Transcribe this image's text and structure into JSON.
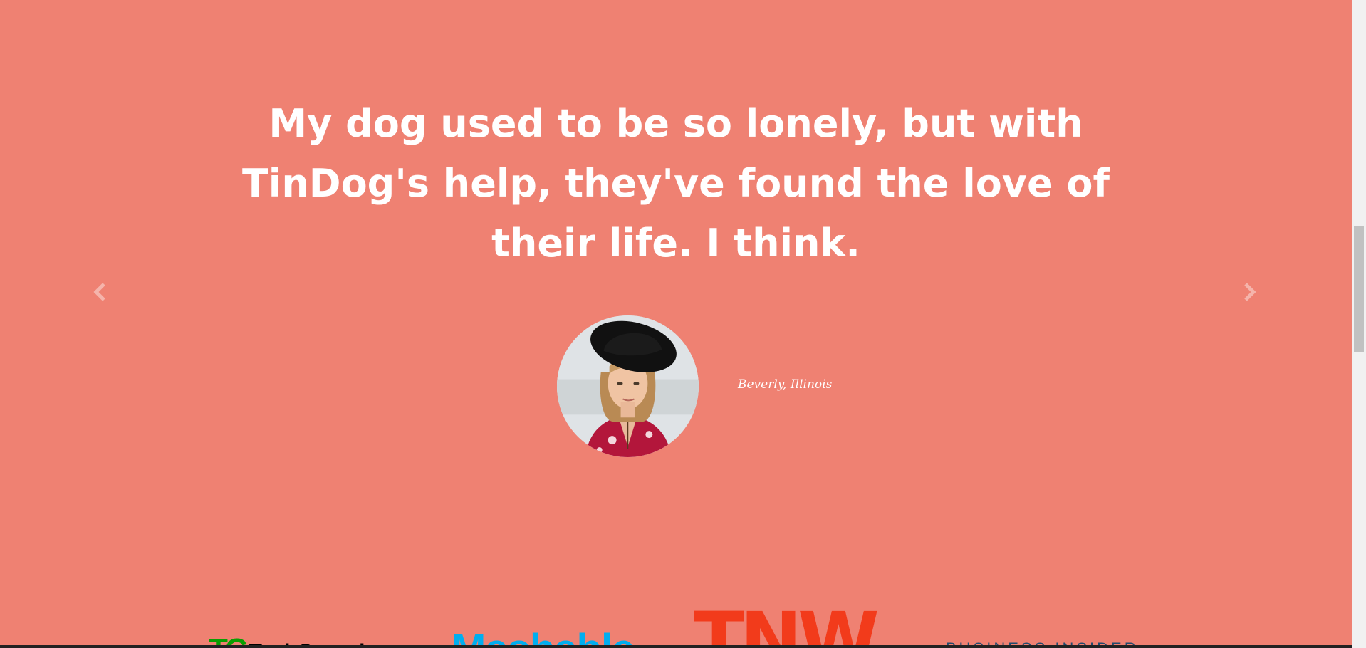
{
  "testimonial": {
    "quote": "My dog used to be so lonely, but with TinDog's help, they've found the love of their life. I think.",
    "author": "Beverly, Illinois"
  },
  "carousel": {
    "prev_icon": "chevron-left-icon",
    "next_icon": "chevron-right-icon"
  },
  "press": {
    "logos": [
      {
        "mark": "TC",
        "word": "TechCrunch"
      },
      {
        "name": "Mashable"
      },
      {
        "name": "TNW"
      },
      {
        "name": "BUSINESS INSIDER"
      }
    ]
  },
  "colors": {
    "background": "#ef8172",
    "text": "#ffffff",
    "techcrunch_green": "#0a9e01",
    "mashable_blue": "#00aeef",
    "tnw_red": "#f23b1b",
    "business_insider_navy": "#1f4b6e"
  }
}
